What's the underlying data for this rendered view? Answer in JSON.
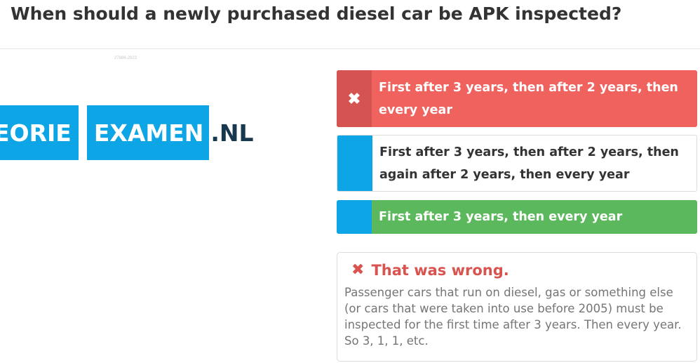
{
  "question": {
    "text": "When should a newly purchased diesel car be APK inspected?"
  },
  "image": {
    "watermark": "27886-2023",
    "logo": {
      "part1": "EORIE",
      "part2": "EXAMEN",
      "suffix": ".NL"
    }
  },
  "answers": [
    {
      "label": "First after 3 years, then after 2 years, then every year",
      "state": "selected-wrong",
      "marker_icon": "x-icon",
      "marker_glyph": "✖"
    },
    {
      "label": "First after 3 years, then after 2 years, then again after 2 years, then every year",
      "state": "unselected"
    },
    {
      "label": "First after 3 years, then every year",
      "state": "correct"
    }
  ],
  "feedback": {
    "icon": "x-icon",
    "icon_glyph": "✖",
    "title": "That was wrong.",
    "body": "Passenger cars that run on diesel, gas or something else (or cars that were taken into use before 2005) must be inspected for the first time after 3 years. Then every year. So 3, 1, 1, etc."
  },
  "colors": {
    "wrong": "#f0625e",
    "wrong_marker": "#d55350",
    "correct": "#5cb85c",
    "accent": "#0ea5e6",
    "feedback_title": "#d9534f"
  }
}
